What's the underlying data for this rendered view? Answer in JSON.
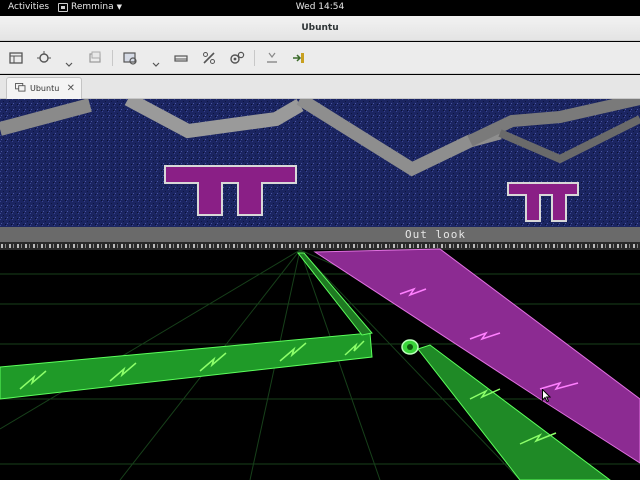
{
  "topbar": {
    "activities": "Activities",
    "app_name": "Remmina",
    "clock": "Wed 14:54"
  },
  "window": {
    "title": "Ubuntu"
  },
  "toolbar": {
    "buttons": [
      "toggle-fullscreen-icon",
      "scaling-icon",
      "scaling-dropdown-icon",
      "grab-keyboard-icon",
      "quality-icon",
      "quality-dropdown-icon",
      "view-only-icon",
      "tools-icon",
      "preferences-icon",
      "minimize-icon",
      "disconnect-icon"
    ]
  },
  "tabs": [
    {
      "label": "Ubuntu",
      "icon": "remote-desktop-icon"
    }
  ],
  "remote": {
    "hud_text": "Out look",
    "colors": {
      "sky": "#1a2560",
      "magenta": "#b02aa6",
      "green": "#2db82d",
      "grid": "#1e5a1e"
    }
  }
}
